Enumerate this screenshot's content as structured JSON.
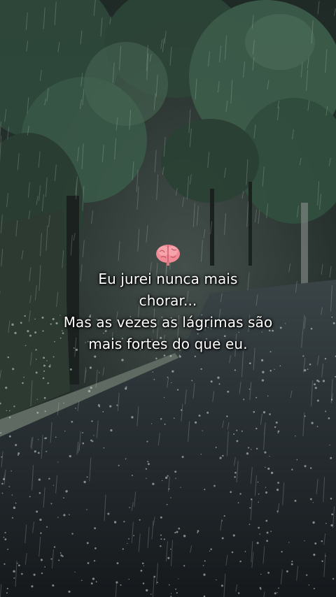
{
  "scene": {
    "description_icon": "brain-emoji"
  },
  "caption": {
    "lines": [
      "Eu jurei nunca mais",
      "chorar...",
      "Mas as vezes as lágrimas são",
      "mais fortes do que eu."
    ]
  }
}
